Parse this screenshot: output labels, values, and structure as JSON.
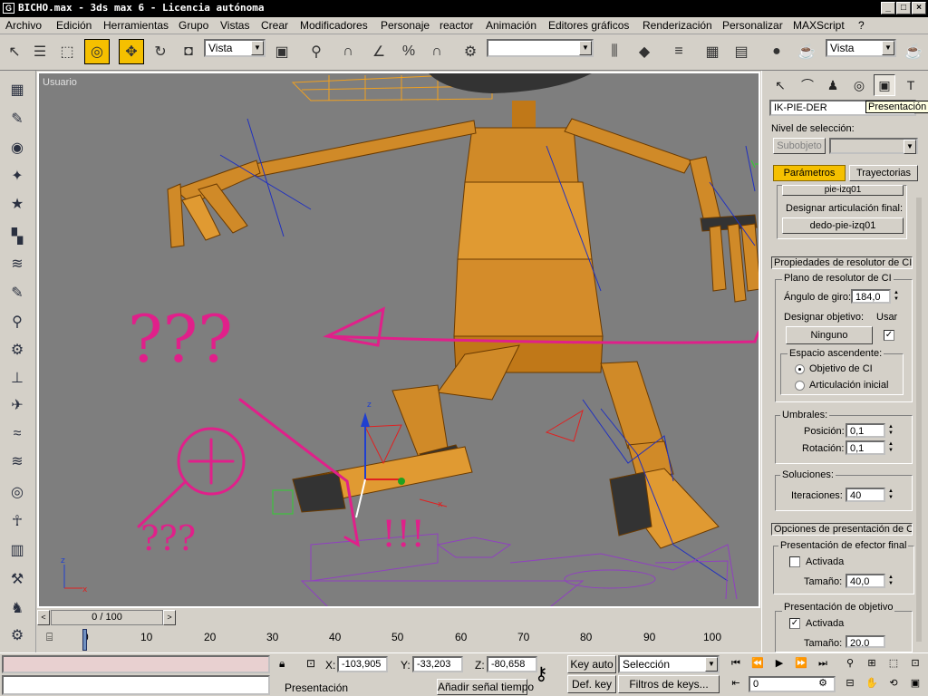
{
  "window": {
    "title": "BICHO.max - 3ds max 6 - Licencia autónoma"
  },
  "menu": [
    "Archivo",
    "Edición",
    "Herramientas",
    "Grupo",
    "Vistas",
    "Crear",
    "Modificadores",
    "Personaje",
    "reactor",
    "Animación",
    "Editores gráficos",
    "Renderización",
    "Personalizar",
    "MAXScript",
    "?"
  ],
  "toolbar": {
    "ref_coord": "Vista",
    "named_sel": "",
    "render_type": "Vista"
  },
  "viewport": {
    "label": "Usuario",
    "axis_x": "x",
    "axis_z": "z",
    "gizmo_x": "x",
    "gizmo_z": "z",
    "annotations": [
      "???",
      "???",
      "!!!"
    ]
  },
  "timeslider": {
    "frame": "0 / 100",
    "prev": "<",
    "next": ">"
  },
  "ruler": {
    "ticks": [
      "0",
      "10",
      "20",
      "30",
      "40",
      "50",
      "60",
      "70",
      "80",
      "90",
      "100"
    ]
  },
  "command_panel": {
    "object_name": "IK-PIE-DER",
    "tooltip": "Presentación",
    "sel_level_label": "Nivel de selección:",
    "subobject_btn": "Subobjeto",
    "tab_params": "Parámetros",
    "tab_traj": "Trayectorias",
    "partial_btn": "pie-izq01",
    "designate_end_btn": "Designar articulación final:",
    "end_joint": "dedo-pie-izq01",
    "rollout_solver": "Propiedades de resolutor de CI",
    "group_plane": "Plano de resolutor de CI",
    "angle_label": "Ángulo de giro:",
    "angle_value": "184,0",
    "target_label": "Designar objetivo:",
    "use_label": "Usar",
    "none_btn": "Ninguno",
    "parent_space": "Espacio ascendente:",
    "radio_target": "Objetivo de CI",
    "radio_start": "Articulación inicial",
    "thresholds": "Umbrales:",
    "position_label": "Posición:",
    "position_value": "0,1",
    "rotation_label": "Rotación:",
    "rotation_value": "0,1",
    "solutions": "Soluciones:",
    "iterations_label": "Iteraciones:",
    "iterations_value": "40",
    "rollout_display": "Opciones de presentación de CI",
    "end_eff_group": "Presentación de efector final",
    "active1": "Activada",
    "size1_label": "Tamaño:",
    "size1_value": "40,0",
    "goal_group": "Presentación de objetivo",
    "active2": "Activada",
    "size2_label": "Tamaño:",
    "size2_value": "20,0"
  },
  "status": {
    "prompt": "Presentación",
    "x_label": "X:",
    "x": "-103,905",
    "y_label": "Y:",
    "y": "-33,203",
    "z_label": "Z:",
    "z": "-80,658",
    "key_auto": "Key auto",
    "selection": "Selección",
    "def_key": "Def. key",
    "key_filters": "Filtros de keys...",
    "add_time_tag": "Añadir señal tiempo",
    "frame": "0"
  }
}
